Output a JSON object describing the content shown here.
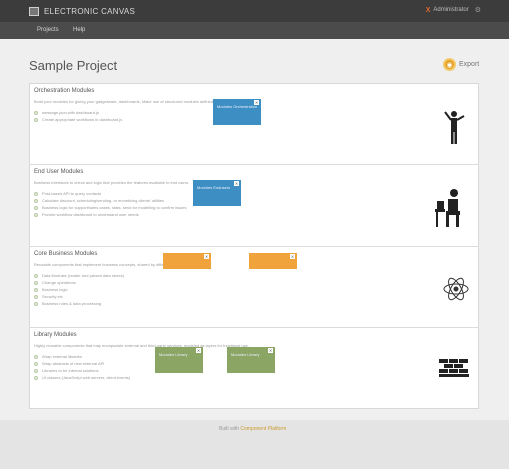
{
  "app": {
    "title": "ELECTRONIC CANVAS"
  },
  "user": {
    "name": "Administrator"
  },
  "nav": {
    "items": [
      "Projects",
      "Help"
    ]
  },
  "page": {
    "title": "Sample Project",
    "export_label": "Export"
  },
  "sections": [
    {
      "title": "Orchestration Modules",
      "description": "Build your modules for gluing your gadgetware, dashboards, Make use of structured modules defined by software.",
      "items": [
        "message.json with dashboard.js",
        "Create appropriate workflows in dashboard.js"
      ],
      "tiles": [
        {
          "label": "Modules Orchestration"
        }
      ]
    },
    {
      "title": "End User Modules",
      "description": "Business interfaces to check and logic that provides the features available to end users.",
      "items": [
        "Post-based API to query contacts",
        "Calculate discount, scheduling/sending, or monetizing clients' utilities",
        "Business logic for support/sales cases, stats, send for modelling to confirm issues",
        "Provide workflow dashboard to understand user needs"
      ],
      "tiles": [
        {
          "label": "Modules Endusers"
        }
      ]
    },
    {
      "title": "Core Business Modules",
      "description": "Reusable components that implement business concepts, shared by different modules.",
      "items": [
        "Data Modules (reader and parsed data stores)",
        "Change operations",
        "Business logic",
        "Security etc",
        "Business rules & data processing"
      ],
      "tiles": [
        {
          "label": ""
        },
        {
          "label": ""
        }
      ]
    },
    {
      "title": "Library Modules",
      "description": "Highly reusable components that may encapsulate external and third-party services, modeled as layers for functional use.",
      "items": [
        "Wrap external libraries",
        "Wrap abstracts of new external API",
        "Libraries to be internal solutions",
        "UI classes (JavaScript web servers, client events)"
      ],
      "tiles": [
        {
          "label": "Modules Library"
        },
        {
          "label": "Modules Library"
        }
      ]
    }
  ],
  "footer": {
    "prefix": "Built with",
    "link": "Component Platform"
  },
  "colors": {
    "blue": "#3d8fc3",
    "orange": "#f0a33a",
    "green": "#8aa564",
    "accent": "#e06a2f"
  },
  "icons": [
    "canvas-logo-icon",
    "gear-icon",
    "export-icon",
    "conductor-icon",
    "desk-user-icon",
    "atom-icon",
    "brick-wall-icon"
  ]
}
